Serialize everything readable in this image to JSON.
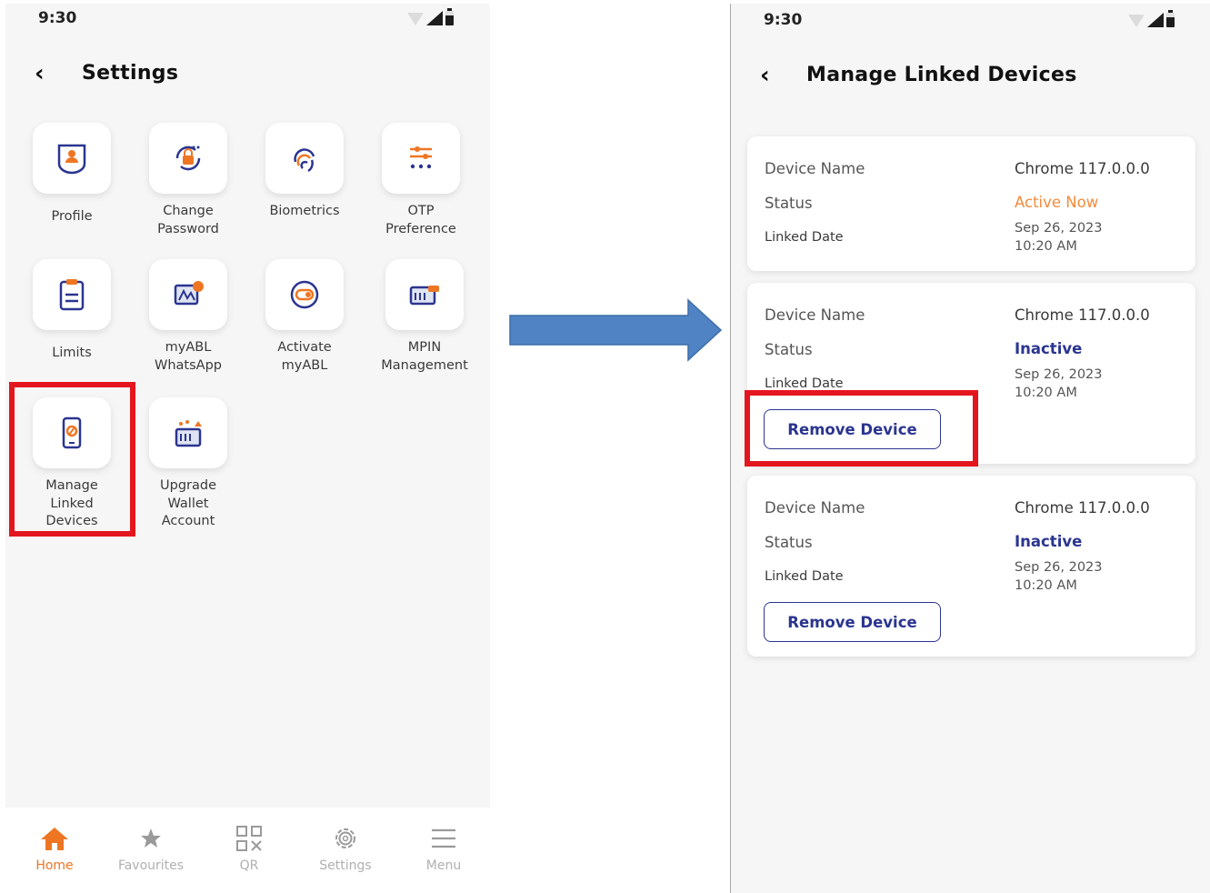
{
  "left": {
    "status_time": "9:30",
    "title": "Settings",
    "tiles": [
      {
        "label": "Profile",
        "icon": "profile-icon"
      },
      {
        "label": "Change\nPassword",
        "icon": "password-icon"
      },
      {
        "label": "Biometrics",
        "icon": "fingerprint-icon"
      },
      {
        "label": "OTP\nPreference",
        "icon": "otp-sliders-icon"
      },
      {
        "label": "Limits",
        "icon": "clipboard-icon"
      },
      {
        "label": "myABL\nWhatsApp",
        "icon": "whatsapp-icon"
      },
      {
        "label": "Activate\nmyABL",
        "icon": "toggle-icon"
      },
      {
        "label": "MPIN\nManagement",
        "icon": "mpin-icon"
      },
      {
        "label": "Manage\nLinked\nDevices",
        "icon": "linked-device-icon"
      },
      {
        "label": "Upgrade\nWallet\nAccount",
        "icon": "upgrade-wallet-icon"
      }
    ],
    "nav": [
      {
        "label": "Home",
        "icon": "home-icon",
        "active": true
      },
      {
        "label": "Favourites",
        "icon": "star-icon"
      },
      {
        "label": "QR",
        "icon": "qr-icon"
      },
      {
        "label": "Settings",
        "icon": "gear-icon"
      },
      {
        "label": "Menu",
        "icon": "hamburger-icon"
      }
    ]
  },
  "right": {
    "status_time": "9:30",
    "title": "Manage Linked Devices",
    "devices": [
      {
        "device_name_label": "Device Name",
        "device_name": "Chrome 117.0.0.0",
        "status_label": "Status",
        "status": "Active Now",
        "linked_date_label": "Linked Date",
        "date": "Sep 26, 2023",
        "time": "10:20 AM"
      },
      {
        "device_name_label": "Device Name",
        "device_name": "Chrome 117.0.0.0",
        "status_label": "Status",
        "status": "Inactive",
        "linked_date_label": "Linked Date",
        "date": "Sep 26, 2023",
        "time": "10:20 AM",
        "button": "Remove Device"
      },
      {
        "device_name_label": "Device Name",
        "device_name": "Chrome 117.0.0.0",
        "status_label": "Status",
        "status": "Inactive",
        "linked_date_label": "Linked Date",
        "date": "Sep 26, 2023",
        "time": "10:20 AM",
        "button": "Remove Device"
      }
    ]
  },
  "colors": {
    "accent_orange": "#ee7623",
    "brand_navy": "#2b3590",
    "highlight_red": "#e3161f",
    "arrow_blue": "#4f83c4"
  }
}
